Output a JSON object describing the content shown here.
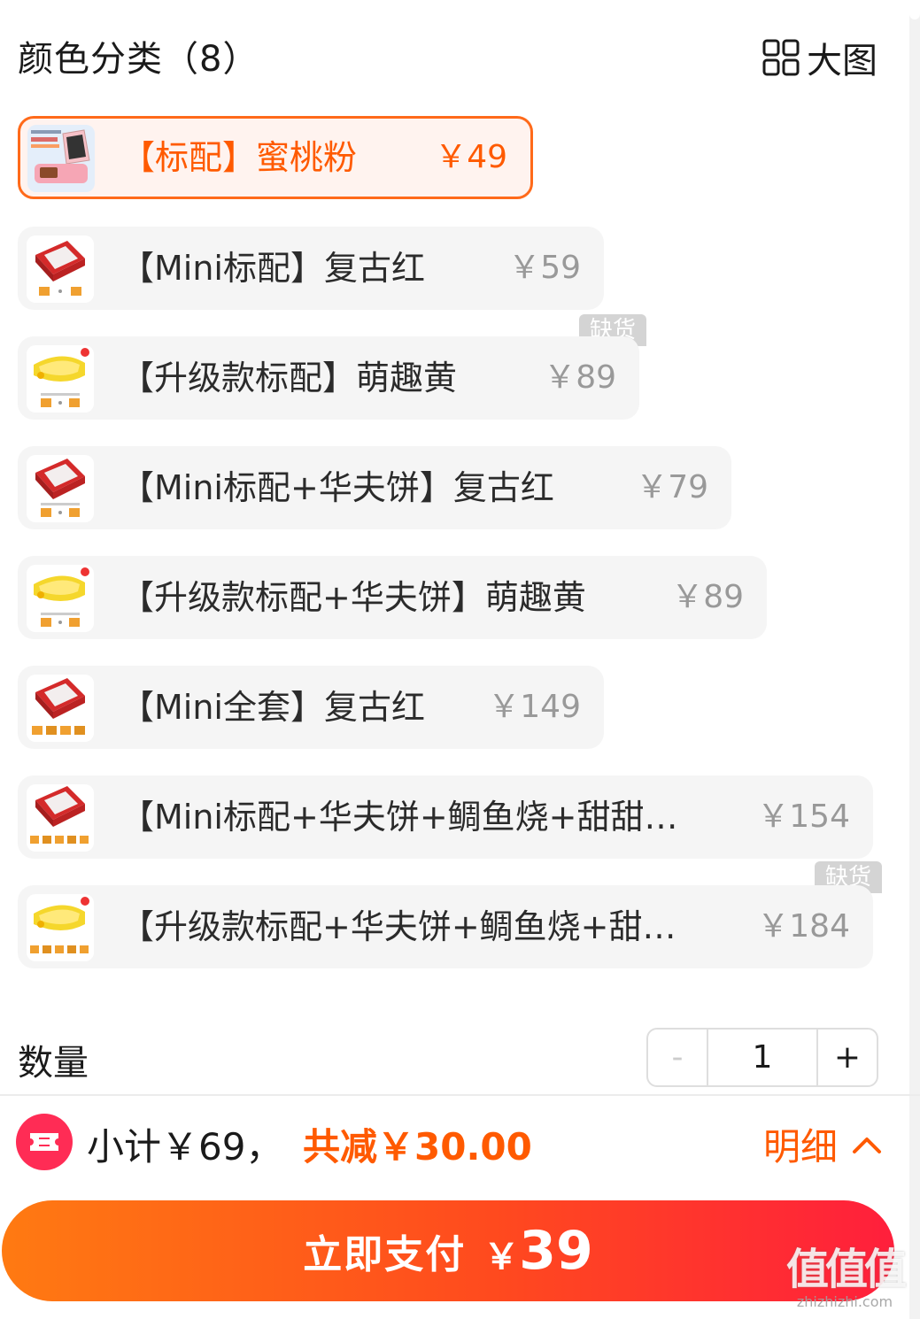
{
  "header": {
    "title": "颜色分类（8）",
    "big_view_label": "大图"
  },
  "options": [
    {
      "label": "【标配】蜜桃粉",
      "price": "￥49",
      "selected": true,
      "product_color": "pink",
      "thumb_texts": [
        "三明治机可拆洗",
        "#独立开关#",
        "早餐轻松做"
      ]
    },
    {
      "label": "【Mini标配】复古红",
      "price": "￥59",
      "selected": false,
      "product_color": "red"
    },
    {
      "label": "【升级款标配】萌趣黄",
      "price": "￥89",
      "selected": false,
      "product_color": "yellow"
    },
    {
      "label": "【Mini标配+华夫饼】复古红",
      "price": "￥79",
      "selected": false,
      "product_color": "red"
    },
    {
      "label": "【升级款标配+华夫饼】萌趣黄",
      "price": "￥89",
      "selected": false,
      "product_color": "yellow"
    },
    {
      "label": "【Mini全套】复古红",
      "price": "￥149",
      "selected": false,
      "product_color": "red"
    },
    {
      "label": "【Mini标配+华夫饼+鲷鱼烧+甜甜…",
      "price": "￥154",
      "selected": false,
      "product_color": "red"
    },
    {
      "label": "【升级款标配+华夫饼+鲷鱼烧+甜…",
      "price": "￥184",
      "selected": false,
      "product_color": "yellow"
    }
  ],
  "soldout_label": "缺货",
  "quantity": {
    "label": "数量",
    "minus": "-",
    "value": "1",
    "plus": "+"
  },
  "footer": {
    "subtotal": "小计￥69，",
    "discount": "共减￥30.00",
    "detail_label": "明细",
    "pay_label": "立即支付",
    "pay_currency": "￥",
    "pay_amount": "39"
  },
  "watermark": {
    "big": "值值值",
    "small": "zhizhizhi.com"
  },
  "colors": {
    "accent": "#ff5a00",
    "selected_bg": "#fff3ef",
    "option_bg": "#f5f5f5",
    "muted_price": "#999999",
    "soldout_bg": "#d4d4d4"
  },
  "icons": {
    "big_view": "grid-icon",
    "detail": "chevron-up-icon",
    "subtotal": "coupon-icon"
  }
}
